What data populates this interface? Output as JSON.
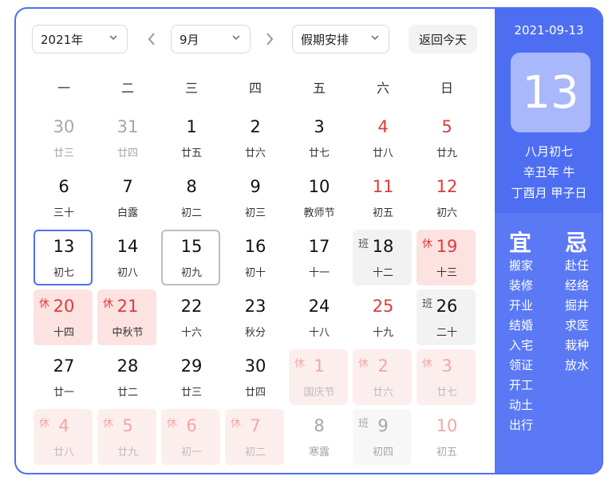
{
  "toolbar": {
    "year_value": "2021年",
    "month_value": "9月",
    "holiday_value": "假期安排",
    "today_button": "返回今天",
    "prev_icon": "chevron-left-icon",
    "next_icon": "chevron-right-icon"
  },
  "weekdays": [
    "一",
    "二",
    "三",
    "四",
    "五",
    "六",
    "日"
  ],
  "colors": {
    "accent": "#4e6ef2",
    "holiday_red": "#e03a3a",
    "rest_bg": "#fde2e2",
    "work_bg": "#f2f2f2"
  },
  "calendar": {
    "days": [
      {
        "day": "30",
        "lunar": "廿三",
        "state": "other"
      },
      {
        "day": "31",
        "lunar": "廿四",
        "state": "other"
      },
      {
        "day": "1",
        "lunar": "廿五",
        "state": "normal"
      },
      {
        "day": "2",
        "lunar": "廿六",
        "state": "normal"
      },
      {
        "day": "3",
        "lunar": "廿七",
        "state": "normal"
      },
      {
        "day": "4",
        "lunar": "廿八",
        "state": "weekend"
      },
      {
        "day": "5",
        "lunar": "廿九",
        "state": "weekend"
      },
      {
        "day": "6",
        "lunar": "三十",
        "state": "normal"
      },
      {
        "day": "7",
        "lunar": "白露",
        "state": "normal"
      },
      {
        "day": "8",
        "lunar": "初二",
        "state": "normal"
      },
      {
        "day": "9",
        "lunar": "初三",
        "state": "normal"
      },
      {
        "day": "10",
        "lunar": "教师节",
        "state": "normal"
      },
      {
        "day": "11",
        "lunar": "初五",
        "state": "weekend"
      },
      {
        "day": "12",
        "lunar": "初六",
        "state": "weekend"
      },
      {
        "day": "13",
        "lunar": "初七",
        "state": "today"
      },
      {
        "day": "14",
        "lunar": "初八",
        "state": "normal"
      },
      {
        "day": "15",
        "lunar": "初九",
        "state": "selected"
      },
      {
        "day": "16",
        "lunar": "初十",
        "state": "normal"
      },
      {
        "day": "17",
        "lunar": "十一",
        "state": "normal"
      },
      {
        "day": "18",
        "lunar": "十二",
        "state": "work",
        "badge": "班"
      },
      {
        "day": "19",
        "lunar": "十三",
        "state": "rest",
        "badge": "休"
      },
      {
        "day": "20",
        "lunar": "十四",
        "state": "rest",
        "badge": "休"
      },
      {
        "day": "21",
        "lunar": "中秋节",
        "state": "rest",
        "badge": "休"
      },
      {
        "day": "22",
        "lunar": "十六",
        "state": "normal"
      },
      {
        "day": "23",
        "lunar": "秋分",
        "state": "normal"
      },
      {
        "day": "24",
        "lunar": "十八",
        "state": "normal"
      },
      {
        "day": "25",
        "lunar": "十九",
        "state": "weekend"
      },
      {
        "day": "26",
        "lunar": "二十",
        "state": "work",
        "badge": "班"
      },
      {
        "day": "27",
        "lunar": "廿一",
        "state": "normal"
      },
      {
        "day": "28",
        "lunar": "廿二",
        "state": "normal"
      },
      {
        "day": "29",
        "lunar": "廿三",
        "state": "normal"
      },
      {
        "day": "30",
        "lunar": "廿四",
        "state": "normal"
      },
      {
        "day": "1",
        "lunar": "国庆节",
        "state": "rest-other",
        "badge": "休"
      },
      {
        "day": "2",
        "lunar": "廿六",
        "state": "rest-other",
        "badge": "休"
      },
      {
        "day": "3",
        "lunar": "廿七",
        "state": "rest-other",
        "badge": "休"
      },
      {
        "day": "4",
        "lunar": "廿八",
        "state": "rest-other",
        "badge": "休"
      },
      {
        "day": "5",
        "lunar": "廿九",
        "state": "rest-other",
        "badge": "休"
      },
      {
        "day": "6",
        "lunar": "初一",
        "state": "rest-other",
        "badge": "休"
      },
      {
        "day": "7",
        "lunar": "初二",
        "state": "rest-other",
        "badge": "休"
      },
      {
        "day": "8",
        "lunar": "寒露",
        "state": "other"
      },
      {
        "day": "9",
        "lunar": "初四",
        "state": "work-other",
        "badge": "班"
      },
      {
        "day": "10",
        "lunar": "初五",
        "state": "other-weekend"
      }
    ]
  },
  "sidebar": {
    "date": "2021-09-13",
    "big_day": "13",
    "lunar_line1": "八月初七",
    "lunar_line2": "辛丑年 牛",
    "lunar_line3": "丁酉月 甲子日",
    "yi_title": "宜",
    "ji_title": "忌",
    "yi_items": [
      "搬家",
      "装修",
      "开业",
      "结婚",
      "入宅",
      "领证",
      "开工",
      "动土",
      "出行"
    ],
    "ji_items": [
      "赴任",
      "经络",
      "掘井",
      "求医",
      "栽种",
      "放水"
    ]
  }
}
